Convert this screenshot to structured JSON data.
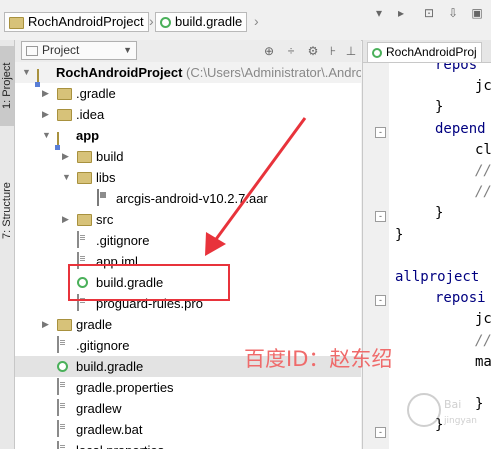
{
  "navbar": {
    "crumbs": [
      {
        "label": "RochAndroidProject",
        "icon": "folder-icon"
      },
      {
        "label": "build.gradle",
        "icon": "gradle-icon"
      }
    ]
  },
  "sidebar": {
    "project_tab": "1: Project",
    "structure_tab": "7: Structure"
  },
  "project_panel": {
    "view_selector": "Project",
    "tree": [
      {
        "label": "RochAndroidProject",
        "path": "(C:\\Users\\Administrator\\.Andro",
        "icon": "module-icon",
        "expanded": true
      },
      {
        "label": ".gradle",
        "icon": "folder-icon",
        "expanded": false
      },
      {
        "label": ".idea",
        "icon": "folder-icon",
        "expanded": false
      },
      {
        "label": "app",
        "icon": "module-icon",
        "expanded": true
      },
      {
        "label": "build",
        "icon": "folder-icon",
        "expanded": false
      },
      {
        "label": "libs",
        "icon": "folder-icon",
        "expanded": true
      },
      {
        "label": "arcgis-android-v10.2.7.aar",
        "icon": "library-icon"
      },
      {
        "label": "src",
        "icon": "folder-icon",
        "expanded": false
      },
      {
        "label": ".gitignore",
        "icon": "file-icon"
      },
      {
        "label": "app.iml",
        "icon": "file-icon"
      },
      {
        "label": "build.gradle",
        "icon": "gradle-icon"
      },
      {
        "label": "proguard-rules.pro",
        "icon": "file-icon"
      },
      {
        "label": "gradle",
        "icon": "folder-icon",
        "expanded": false
      },
      {
        "label": ".gitignore",
        "icon": "file-icon"
      },
      {
        "label": "build.gradle",
        "icon": "gradle-icon"
      },
      {
        "label": "gradle.properties",
        "icon": "file-icon"
      },
      {
        "label": "gradlew",
        "icon": "file-icon"
      },
      {
        "label": "gradlew.bat",
        "icon": "file-icon"
      },
      {
        "label": "local.properties",
        "icon": "file-icon"
      }
    ]
  },
  "editor": {
    "tab_label": "RochAndroidProj",
    "lines": [
      "repos",
      "jc",
      "}",
      "depend",
      "cl",
      "//",
      "//",
      "}",
      "}",
      "",
      "allproject",
      "reposi",
      "jc",
      "//",
      "ma",
      "",
      "}",
      "}"
    ]
  },
  "watermark": "百度ID：赵东绍",
  "colors": {
    "accent_red": "#e8333b",
    "gradle_green": "#4ab05a",
    "keyword_navy": "#000080"
  }
}
